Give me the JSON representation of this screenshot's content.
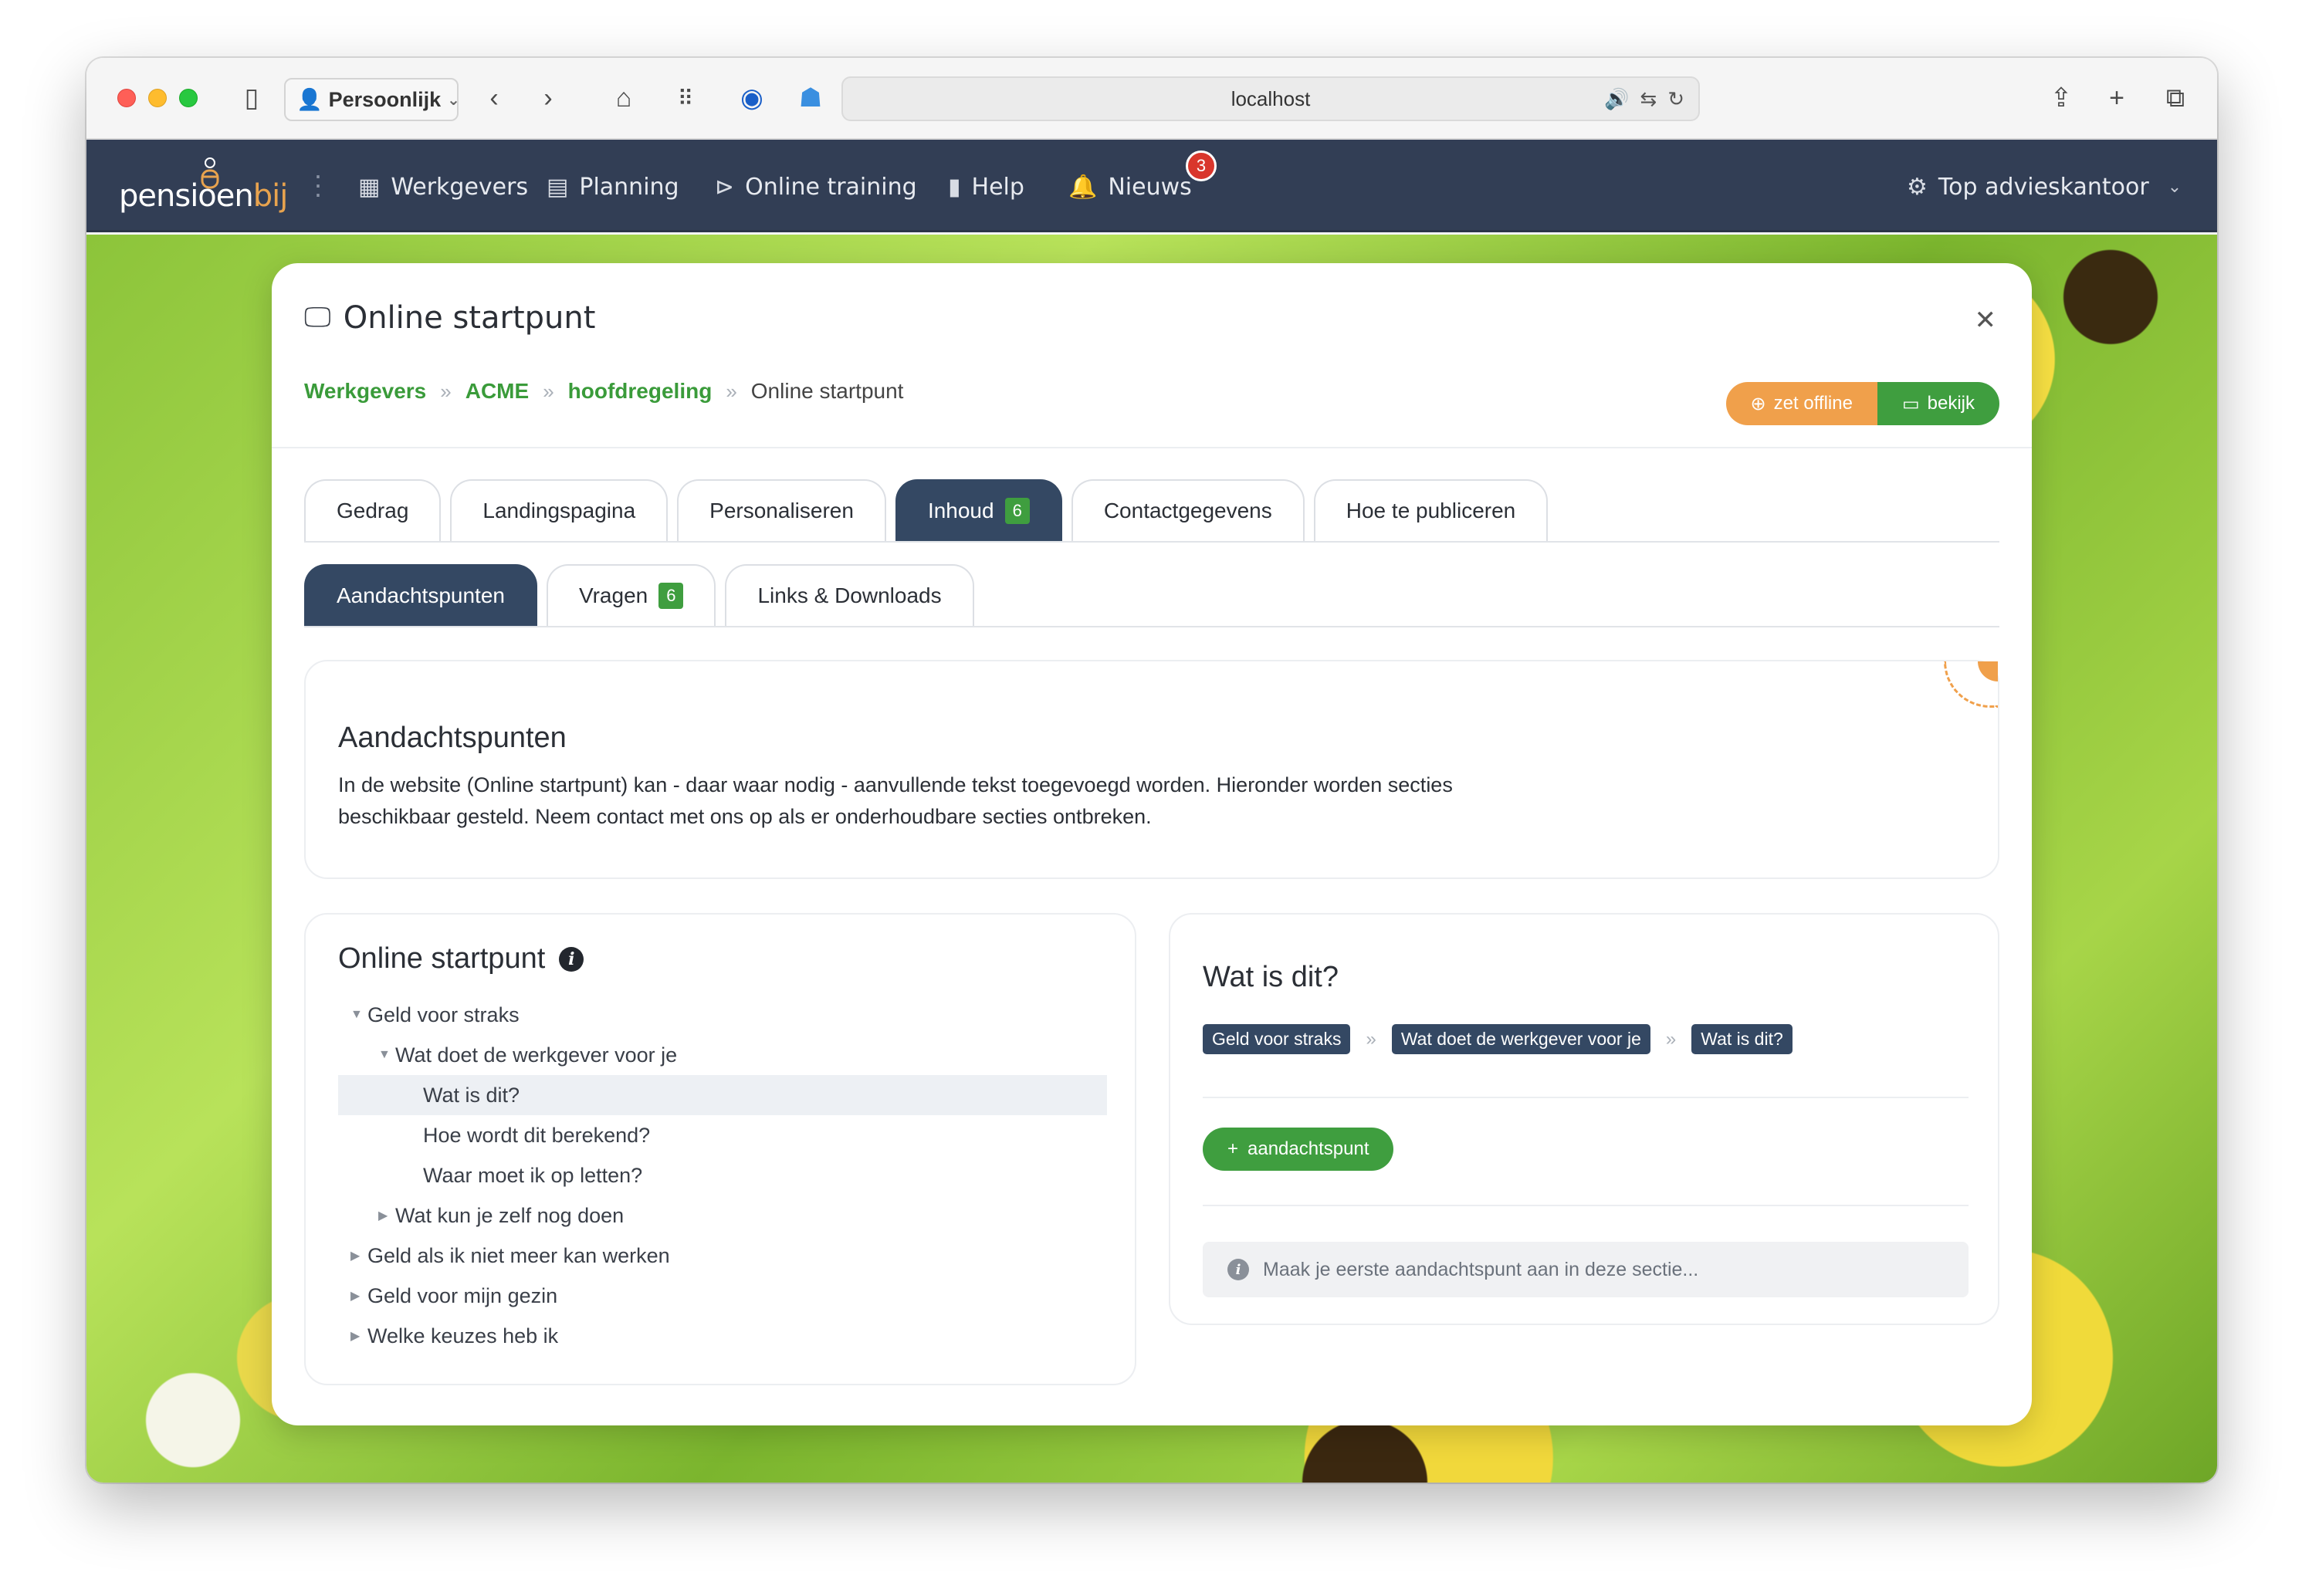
{
  "browser": {
    "profile": "Persoonlijk",
    "url": "localhost"
  },
  "nav": {
    "logo_main": "pensioen",
    "logo_accent": "bij",
    "items": [
      {
        "label": "Werkgevers",
        "icon": "briefcase-icon"
      },
      {
        "label": "Planning",
        "icon": "calendar-icon"
      },
      {
        "label": "Online training",
        "icon": "play-circle-icon"
      },
      {
        "label": "Help",
        "icon": "book-icon"
      },
      {
        "label": "Nieuws",
        "icon": "bell-icon"
      }
    ],
    "news_count": "3",
    "account": "Top advieskantoor"
  },
  "modal": {
    "title": "Online startpunt",
    "breadcrumb": [
      "Werkgevers",
      "ACME",
      "hoofdregeling"
    ],
    "breadcrumb_current": "Online startpunt",
    "btn_offline": "zet offline",
    "btn_bekijk": "bekijk",
    "tabs": [
      {
        "label": "Gedrag"
      },
      {
        "label": "Landingspagina"
      },
      {
        "label": "Personaliseren"
      },
      {
        "label": "Inhoud",
        "count": "6"
      },
      {
        "label": "Contactgegevens"
      },
      {
        "label": "Hoe te publiceren"
      }
    ],
    "subtabs": [
      {
        "label": "Aandachtspunten"
      },
      {
        "label": "Vragen",
        "count": "6"
      },
      {
        "label": "Links & Downloads"
      }
    ]
  },
  "intro": {
    "title": "Aandachtspunten",
    "text": "In de website (Online startpunt) kan - daar waar nodig - aanvullende tekst toegevoegd worden. Hieronder worden secties beschikbaar gesteld. Neem contact met ons op als er onderhoudbare secties ontbreken."
  },
  "tree": {
    "title": "Online startpunt",
    "items": [
      {
        "label": "Geld voor straks"
      },
      {
        "label": "Wat doet de werkgever voor je"
      },
      {
        "label": "Wat is dit?"
      },
      {
        "label": "Hoe wordt dit berekend?"
      },
      {
        "label": "Waar moet ik op letten?"
      },
      {
        "label": "Wat kun je zelf nog doen"
      },
      {
        "label": "Geld als ik niet meer kan werken"
      },
      {
        "label": "Geld voor mijn gezin"
      },
      {
        "label": "Welke keuzes heb ik"
      }
    ]
  },
  "detail": {
    "title": "Wat is dit?",
    "path": [
      "Geld voor straks",
      "Wat doet de werkgever voor je",
      "Wat is dit?"
    ],
    "btn_add": "aandachtspunt",
    "notice": "Maak je eerste aandachtspunt aan in deze sectie..."
  },
  "colors": {
    "nav_bg": "#323e55",
    "accent_green": "#3f9e3f",
    "accent_orange": "#f0a04b",
    "tab_active": "#344863"
  }
}
